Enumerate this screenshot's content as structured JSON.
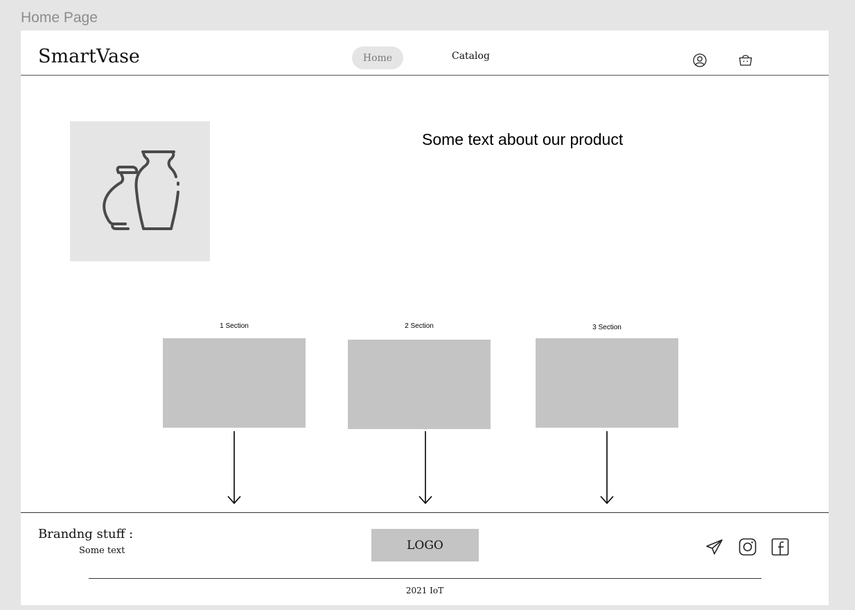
{
  "frame": {
    "title": "Home Page"
  },
  "header": {
    "brand": "SmartVase",
    "nav": {
      "home": "Home",
      "catalog": "Catalog"
    },
    "icons": [
      "user-icon",
      "basket-icon"
    ]
  },
  "hero": {
    "image_icon": "vases-icon",
    "text": "Some text about our product"
  },
  "sections": [
    {
      "label": "1 Section"
    },
    {
      "label": "2 Section"
    },
    {
      "label": "3 Section"
    }
  ],
  "footer": {
    "branding_title": "Brandng stuff :",
    "branding_text": "Some text",
    "logo": "LOGO",
    "social_icons": [
      "telegram-icon",
      "instagram-icon",
      "facebook-icon"
    ],
    "copyright": "2021 IoT"
  },
  "colors": {
    "background": "#e5e5e5",
    "placeholder": "#c4c4c4",
    "artboard": "#ffffff"
  }
}
